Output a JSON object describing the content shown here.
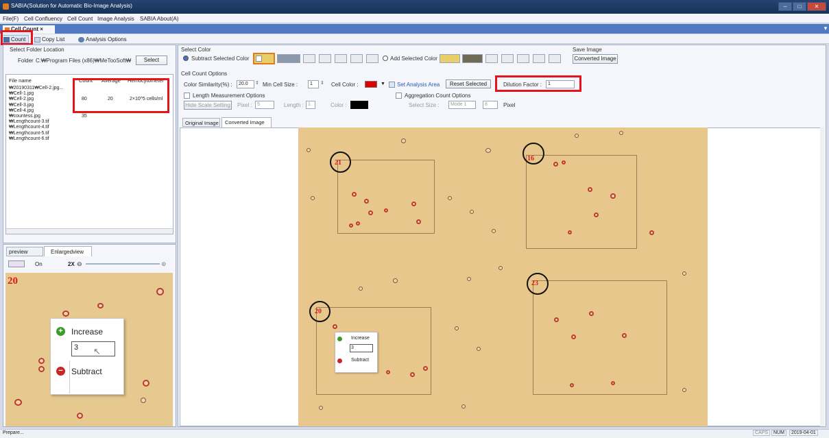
{
  "window": {
    "title": "SABIA(Solution for Automatic Bio-Image Analysis)"
  },
  "menu": [
    "File(F)",
    "Cell Confluency",
    "Cell Count",
    "Image Analysis",
    "SABIA About(A)"
  ],
  "doc_tab": "Cell Count ×",
  "toolbar": {
    "count": "Count",
    "copy_list": "Copy List",
    "analysis_options": "Analysis Options"
  },
  "folder": {
    "section": "Select Folder Location",
    "label": "Folder",
    "path": "C:₩Program Files (x86)₩MeTooSoft₩",
    "select": "Select"
  },
  "table": {
    "headers": [
      "File name",
      "Count",
      "Average",
      "Hemocytometer"
    ],
    "rows": [
      {
        "name": "₩20190311₩Cell-2.jpg...",
        "count": "",
        "avg": "",
        "hemo": ""
      },
      {
        "name": "₩Cell-1.jpg",
        "count": "",
        "avg": "",
        "hemo": ""
      },
      {
        "name": "₩Cell-2.jpg",
        "count": "80",
        "avg": "20",
        "hemo": "2×10^5 cells/ml"
      },
      {
        "name": "₩Cell-3.jpg",
        "count": "",
        "avg": "",
        "hemo": ""
      },
      {
        "name": "₩Cell-4.jpg",
        "count": "",
        "avg": "",
        "hemo": ""
      },
      {
        "name": "₩countess.jpg",
        "count": "35",
        "avg": "",
        "hemo": ""
      },
      {
        "name": "₩Lengthcount-3.tif",
        "count": "",
        "avg": "",
        "hemo": ""
      },
      {
        "name": "₩Lengthcount-4.tif",
        "count": "",
        "avg": "",
        "hemo": ""
      },
      {
        "name": "₩Lengthcount-5.tif",
        "count": "",
        "avg": "",
        "hemo": ""
      },
      {
        "name": "₩Lengthcount-6.tif",
        "count": "",
        "avg": "",
        "hemo": ""
      }
    ]
  },
  "preview": {
    "tab_preview": "preview",
    "tab_enlarged": "Enlargedview",
    "on": "On",
    "zoom": "2X",
    "count_label": "20",
    "increase": "Increase",
    "value": "3",
    "subtract": "Subtract"
  },
  "select_color": {
    "section": "Select Color",
    "subtract": "Subtract Selected Color",
    "add": "Add Selected Color"
  },
  "save_image": {
    "section": "Save Image",
    "button": "Converted Image"
  },
  "cell_count_options": {
    "section": "Cell Count Options",
    "similarity_label": "Color Similarity(%) :",
    "similarity_value": "20.0",
    "min_cell_label": "Min Cell Size :",
    "min_cell_value": "1",
    "cell_color_label": "Cell Color :",
    "set_area": "Set Analysis Area",
    "reset": "Reset Selected",
    "dilution_label": "Dilution Factor :",
    "dilution_value": "1"
  },
  "length_options": {
    "label": "Length Measurement Options",
    "hide": "Hide Scale Setting",
    "pixel_label": "Pixel :",
    "pixel_value": "5",
    "length_label": "Length :",
    "length_value": "1",
    "color_label": "Color :"
  },
  "aggregation": {
    "label": "Aggregation Count Options",
    "size_label": "Select Size :",
    "mode": "Mode 1",
    "value": "8",
    "unit": "Pixel"
  },
  "image_tabs": [
    "Original Image",
    "Converted Image"
  ],
  "grid_counts": [
    "21",
    "16",
    "20",
    "23"
  ],
  "popup": {
    "increase": "Increase",
    "value": "3",
    "subtract": "Subtract"
  },
  "status": {
    "text": "Prepare...",
    "caps": "CAPS",
    "num": "NUM",
    "date": "2019-04-01"
  },
  "colors": {
    "accent": "#e4141b",
    "cell_color": "#e00000",
    "image_bg": "#e8c78d",
    "swatch_grey": "#8b98aa",
    "swatch_olive": "#6f6b56",
    "swatch_yellow": "#e6cf6a"
  }
}
